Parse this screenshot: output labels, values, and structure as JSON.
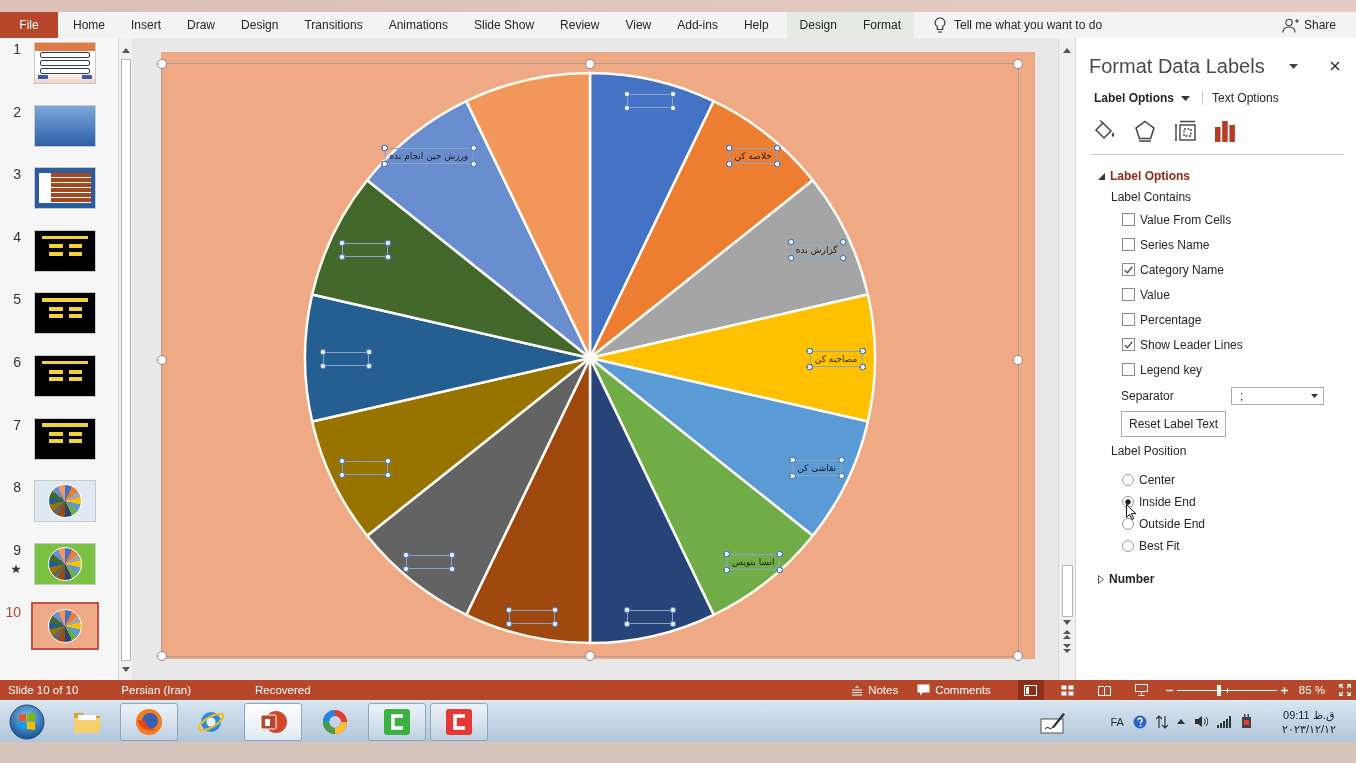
{
  "ribbon": {
    "file_tab": "File",
    "tabs": [
      {
        "label": "Home",
        "selected": false
      },
      {
        "label": "Insert",
        "selected": false
      },
      {
        "label": "Draw",
        "selected": false
      },
      {
        "label": "Design",
        "selected": false
      },
      {
        "label": "Transitions",
        "selected": false
      },
      {
        "label": "Animations",
        "selected": false
      },
      {
        "label": "Slide Show",
        "selected": false
      },
      {
        "label": "Review",
        "selected": false
      },
      {
        "label": "View",
        "selected": false
      },
      {
        "label": "Add-ins",
        "selected": false
      },
      {
        "label": "Help",
        "selected": false
      }
    ],
    "contextual_tabs": [
      {
        "label": "Design",
        "selected": false
      },
      {
        "label": "Format",
        "selected": false
      }
    ],
    "tell_me": {
      "placeholder": "Tell me what you want to do"
    },
    "share": "Share"
  },
  "slides_pane": {
    "slides": [
      {
        "number": "1",
        "kind": "form",
        "animated": false,
        "selected": false
      },
      {
        "number": "2",
        "kind": "gradient",
        "animated": false,
        "selected": false
      },
      {
        "number": "3",
        "kind": "table",
        "animated": false,
        "selected": false
      },
      {
        "number": "4",
        "kind": "menu",
        "animated": false,
        "selected": false
      },
      {
        "number": "5",
        "kind": "menu",
        "animated": false,
        "selected": false
      },
      {
        "number": "6",
        "kind": "menu",
        "animated": false,
        "selected": false
      },
      {
        "number": "7",
        "kind": "menu",
        "animated": false,
        "selected": false
      },
      {
        "number": "8",
        "kind": "wheel",
        "color": "#dfe9f4",
        "animated": false,
        "selected": false
      },
      {
        "number": "9",
        "kind": "wheel",
        "color": "#7cc242",
        "animated": true,
        "selected": false
      },
      {
        "number": "10",
        "kind": "wheel",
        "color": "#f0a987",
        "animated": false,
        "selected": true
      }
    ]
  },
  "slide": {
    "chart": {
      "selected": true,
      "slices": [
        {
          "color": "#4472c4",
          "label_selected": true
        },
        {
          "color": "#ed7d31",
          "label": "خلاصه کن",
          "label_selected": true
        },
        {
          "color": "#a5a5a5",
          "label": "گزارش بده",
          "label_selected": true
        },
        {
          "color": "#ffc000",
          "label": "مصاحبه کن",
          "label_selected": true
        },
        {
          "color": "#5b9bd5",
          "label": "نقاشی کن",
          "label_selected": true
        },
        {
          "color": "#70ad47",
          "label": "انشا بنویس",
          "label_selected": true
        },
        {
          "color": "#264478",
          "label_selected": true
        },
        {
          "color": "#9e480e",
          "label_selected": true
        },
        {
          "color": "#636363",
          "label_selected": true
        },
        {
          "color": "#997300",
          "label_selected": true
        },
        {
          "color": "#255e91",
          "label_selected": true
        },
        {
          "color": "#43682b",
          "label_selected": true
        },
        {
          "color": "#698ed0",
          "label": "ورزش حین انجام بده",
          "label_selected": true
        },
        {
          "color": "#f1975a",
          "label_selected": false
        }
      ]
    }
  },
  "format_pane": {
    "title": "Format Data Labels",
    "option_tabs": [
      {
        "label": "Label Options",
        "selected": true
      },
      {
        "label": "Text Options",
        "selected": false
      }
    ],
    "icon_tabs": [
      {
        "kind": "fill",
        "selected": false
      },
      {
        "kind": "effects",
        "selected": false
      },
      {
        "kind": "size",
        "selected": false
      },
      {
        "kind": "options",
        "selected": true
      }
    ],
    "sections": [
      {
        "title": "Label Options",
        "expanded": true,
        "contains_heading": "Label Contains",
        "checkboxes": [
          {
            "label": "Value From Cells",
            "checked": false
          },
          {
            "label": "Series Name",
            "checked": false
          },
          {
            "label": "Category Name",
            "checked": true
          },
          {
            "label": "Value",
            "checked": false
          },
          {
            "label": "Percentage",
            "checked": false
          },
          {
            "label": "Show Leader Lines",
            "checked": true
          },
          {
            "label": "Legend key",
            "checked": false
          }
        ],
        "separator": {
          "label": "Separator",
          "value": ";"
        },
        "reset_button": "Reset Label Text",
        "position_heading": "Label Position",
        "positions": [
          {
            "label": "Center",
            "selected": false
          },
          {
            "label": "Inside End",
            "selected": true
          },
          {
            "label": "Outside End",
            "selected": false
          },
          {
            "label": "Best Fit",
            "selected": false
          }
        ]
      },
      {
        "title": "Number",
        "expanded": false
      }
    ]
  },
  "status_bar": {
    "slide_count": "Slide 10 of 10",
    "language": "Persian (Iran)",
    "save_state": "Recovered",
    "notes": "Notes",
    "comments": "Comments",
    "views": [
      {
        "kind": "normal",
        "selected": true
      },
      {
        "kind": "sorter",
        "selected": false
      },
      {
        "kind": "reading",
        "selected": false
      },
      {
        "kind": "slideshow",
        "selected": false
      }
    ],
    "zoom": {
      "level": 0.42,
      "reading": "85 %"
    }
  },
  "taskbar": {
    "apps": [
      {
        "kind": "folder",
        "running": false,
        "active": false
      },
      {
        "kind": "fox",
        "running": true,
        "active": false
      },
      {
        "kind": "globe",
        "running": false,
        "active": false
      },
      {
        "kind": "presentation",
        "running": true,
        "active": true
      },
      {
        "kind": "ring",
        "running": false,
        "active": false
      },
      {
        "kind": "bracket",
        "color": "#3cb043",
        "running": true,
        "active": false
      },
      {
        "kind": "bracket",
        "color": "#e53935",
        "running": true,
        "active": false
      }
    ],
    "language": "FA",
    "time": "ق.ظ 09:11",
    "date": "۲۰۲۳/۱۲/۱۲"
  }
}
